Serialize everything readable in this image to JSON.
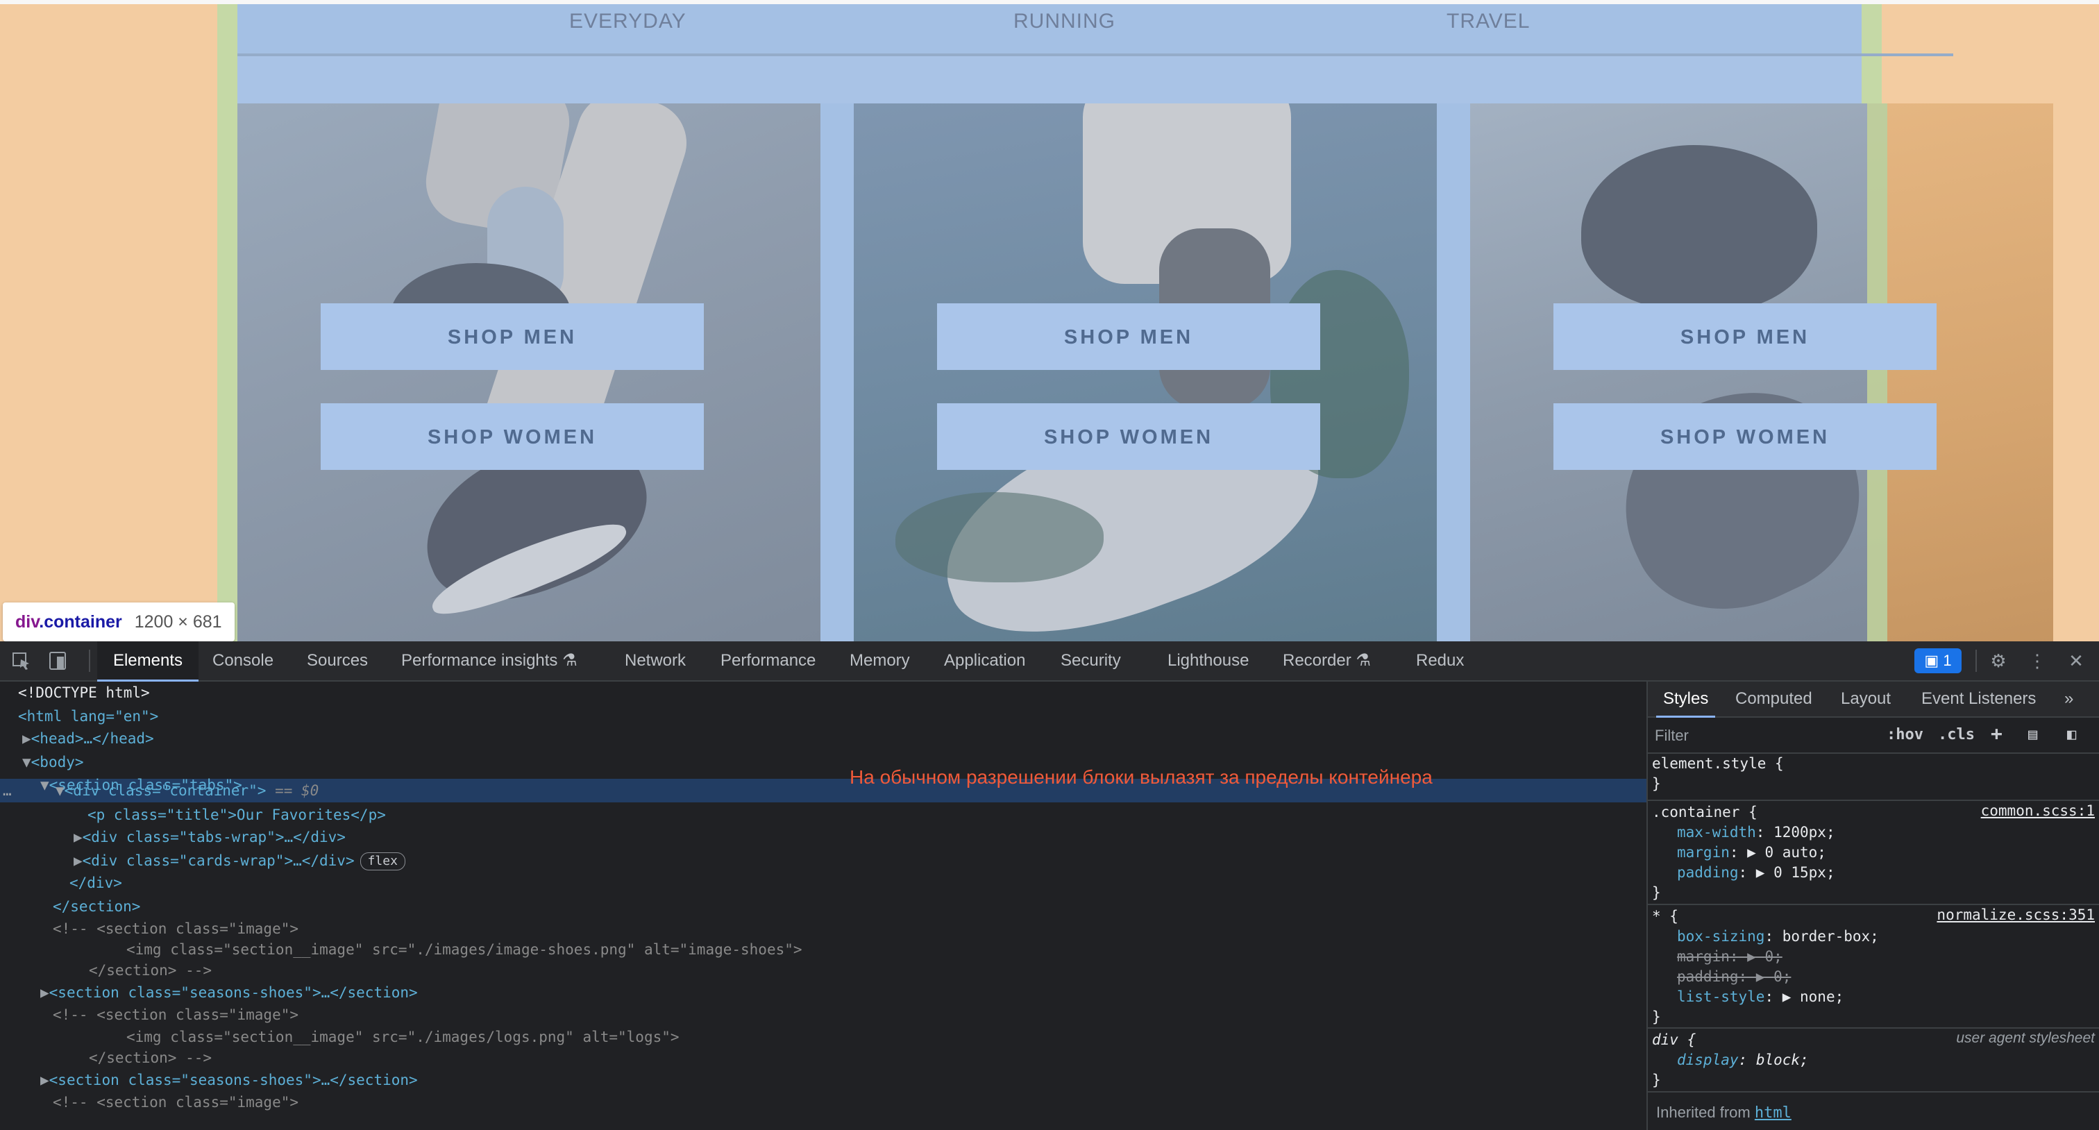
{
  "page": {
    "tabs": [
      "EVERYDAY",
      "RUNNING",
      "TRAVEL"
    ],
    "cards": [
      {
        "shop_men": "SHOP MEN",
        "shop_women": "SHOP WOMEN"
      },
      {
        "shop_men": "SHOP MEN",
        "shop_women": "SHOP WOMEN"
      },
      {
        "shop_men": "SHOP MEN",
        "shop_women": "SHOP WOMEN"
      }
    ],
    "tooltip": {
      "tag": "div",
      "cls": ".container",
      "size": "1200 × 681"
    }
  },
  "devtools": {
    "tabs": [
      "Elements",
      "Console",
      "Sources",
      "Performance insights",
      "Network",
      "Performance",
      "Memory",
      "Application",
      "Security",
      "Lighthouse",
      "Recorder",
      "Redux"
    ],
    "active_tab": "Elements",
    "issues_count": "1",
    "annotation": "На обычном разрешении блоки вылазят за пределы контейнера",
    "dom": {
      "doctype": "<!DOCTYPE html>",
      "html_open": "<html lang=\"en\">",
      "head": "<head>…</head>",
      "body_open": "<body>",
      "section_tabs": "<section class=\"tabs\">",
      "container": "<div class=\"container\">",
      "container_marker": "== $0",
      "p_title": "<p class=\"title\">Our Favorites</p>",
      "tabs_wrap": "<div class=\"tabs-wrap\">…</div>",
      "cards_wrap": "<div class=\"cards-wrap\">…</div>",
      "flex_badge": "flex",
      "div_close": "</div>",
      "section_close": "</section>",
      "comment1_open": "<!-- <section class=\"image\">",
      "comment1_img": "<img class=\"section__image\" src=\"./images/image-shoes.png\" alt=\"image-shoes\">",
      "comment_close": "</section> -->",
      "seasons1": "<section class=\"seasons-shoes\">…</section>",
      "comment2_open": "<!-- <section class=\"image\">",
      "comment2_img": "<img class=\"section__image\" src=\"./images/logs.png\" alt=\"logs\">",
      "seasons2": "<section class=\"seasons-shoes\">…</section>",
      "comment3_open": "<!-- <section class=\"image\">"
    },
    "styles": {
      "tabs": [
        "Styles",
        "Computed",
        "Layout",
        "Event Listeners"
      ],
      "filter_placeholder": "Filter",
      "hov": ":hov",
      "cls": ".cls",
      "element_style": "element.style {",
      "container_selector": ".container {",
      "container_src": "common.scss:1",
      "container_props": [
        {
          "name": "max-width",
          "value": "1200px;"
        },
        {
          "name": "margin",
          "value": "0 auto;"
        },
        {
          "name": "padding",
          "value": "0 15px;"
        }
      ],
      "star_selector": "* {",
      "star_src": "normalize.scss:351",
      "star_props": [
        {
          "name": "box-sizing",
          "value": "border-box;"
        },
        {
          "name": "margin",
          "value": "0;"
        },
        {
          "name": "padding",
          "value": "0;"
        },
        {
          "name": "list-style",
          "value": "none;"
        }
      ],
      "div_selector": "div {",
      "div_src": "user agent stylesheet",
      "div_prop": {
        "name": "display",
        "value": "block;"
      },
      "close_brace": "}",
      "inherited_label": "Inherited from",
      "inherited_el": "html"
    }
  }
}
